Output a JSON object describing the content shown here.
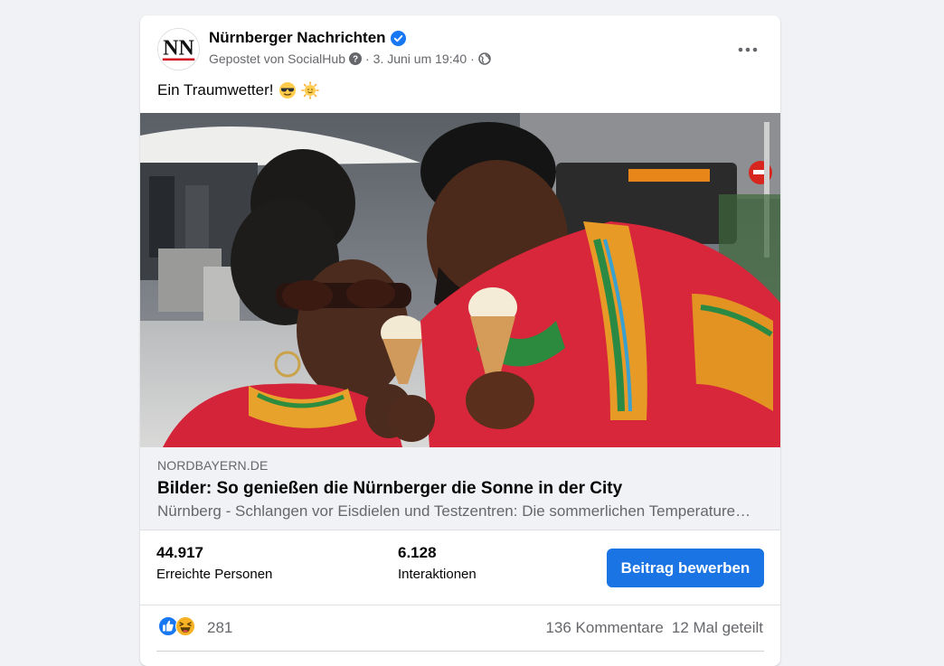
{
  "post": {
    "page_name": "Nürnberger Nachrichten",
    "avatar_text": "NN",
    "posted_by": "Gepostet von SocialHub",
    "date": "3. Juni um 19:40",
    "separator": "·",
    "text": "Ein Traumwetter!",
    "emojis": [
      "sunglasses-emoji",
      "sun-emoji"
    ]
  },
  "link_preview": {
    "domain": "NORDBAYERN.DE",
    "title": "Bilder: So genießen die Nürnberger die Sonne in der City",
    "description": "Nürnberg - Schlangen vor Eisdielen und Testzentren: Die sommerlichen Temperaturen locken die Menschen in die Innenstadt"
  },
  "insights": {
    "reach_value": "44.917",
    "reach_label": "Erreichte Personen",
    "engagement_value": "6.128",
    "engagement_label": "Interaktionen",
    "boost_label": "Beitrag bewerben"
  },
  "reactions": {
    "icons": [
      "like-icon",
      "haha-icon"
    ],
    "count": "281",
    "comments": "136 Kommentare",
    "shares": "12 Mal geteilt"
  },
  "colors": {
    "background": "#f0f2f5",
    "card": "#ffffff",
    "primary_text": "#050505",
    "secondary_text": "#65676b",
    "accent_blue": "#1b74e4",
    "verified_blue": "#1877f2",
    "brand_red": "#d0021b"
  }
}
